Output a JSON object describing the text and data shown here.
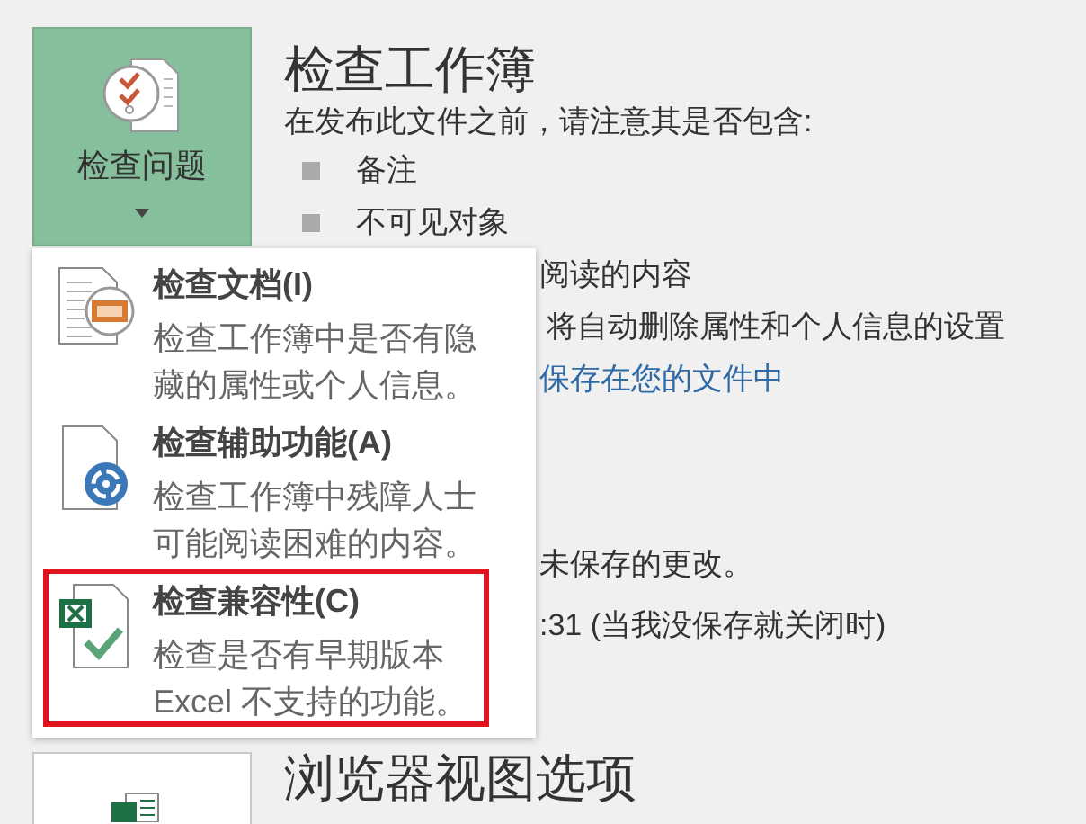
{
  "inspect_button": {
    "label": "检查问题"
  },
  "section": {
    "title": "检查工作簿",
    "subtitle": "在发布此文件之前，请注意其是否包含:",
    "bullets": [
      "备注",
      "不可见对象"
    ]
  },
  "covered_lines": [
    {
      "kind": "text",
      "text": "阅读的内容"
    },
    {
      "kind": "text",
      "text": "将自动删除属性和个人信息的设置"
    },
    {
      "kind": "link",
      "text": "保存在您的文件中"
    },
    {
      "kind": "text",
      "text": "未保存的更改。"
    },
    {
      "kind": "text",
      "text": ":31 (当我没保存就关闭时)"
    }
  ],
  "menu": {
    "items": [
      {
        "kind": "document",
        "title": "检查文档(I)",
        "description_lines": [
          "检查工作簿中是否有隐",
          "藏的属性或个人信息。"
        ],
        "highlighted": false
      },
      {
        "kind": "accessibility",
        "title": "检查辅助功能(A)",
        "description_lines": [
          "检查工作簿中残障人士",
          "可能阅读困难的内容。"
        ],
        "highlighted": false
      },
      {
        "kind": "compatibility",
        "title": "检查兼容性(C)",
        "description_lines": [
          "检查是否有早期版本",
          "Excel 不支持的功能。"
        ],
        "highlighted": true
      }
    ]
  },
  "next_section": {
    "title": "浏览器视图选项"
  }
}
